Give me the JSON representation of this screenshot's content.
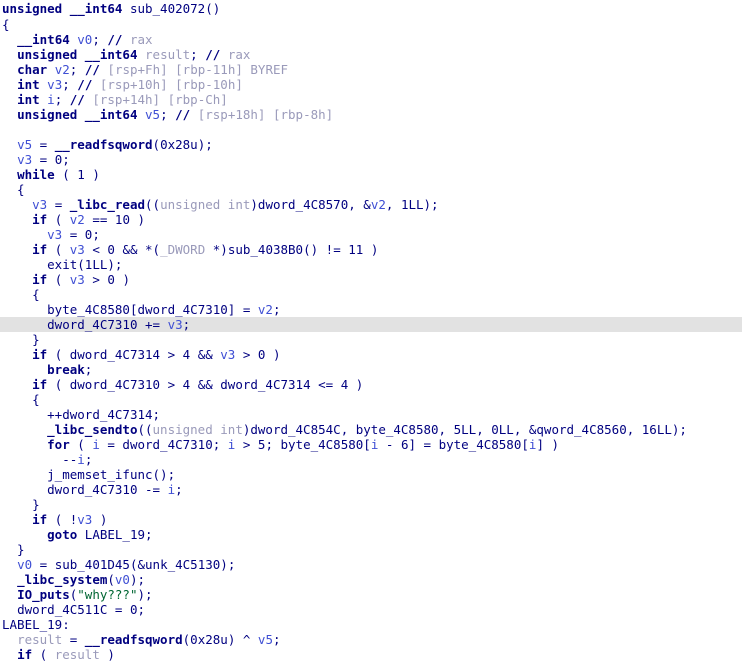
{
  "view": {
    "name": "hex-rays-pseudocode",
    "function_name": "sub_402072",
    "highlighted_line_index": 20,
    "colors": {
      "background": "#ffffff",
      "highlight": "#e2e2e2",
      "keyword": "#000080",
      "local_variable": "#3f4fd4",
      "comment": "#9a9aba",
      "string_literal": "#006633",
      "result_variable": "#9a9aba"
    }
  },
  "lines": [
    {
      "n": 1,
      "text": "unsigned __int64 sub_402072()"
    },
    {
      "n": 2,
      "text": "{"
    },
    {
      "n": 3,
      "text": "  __int64 v0; // rax"
    },
    {
      "n": 4,
      "text": "  unsigned __int64 result; // rax"
    },
    {
      "n": 5,
      "text": "  char v2; // [rsp+Fh] [rbp-11h] BYREF"
    },
    {
      "n": 6,
      "text": "  int v3; // [rsp+10h] [rbp-10h]"
    },
    {
      "n": 7,
      "text": "  int i; // [rsp+14h] [rbp-Ch]"
    },
    {
      "n": 8,
      "text": "  unsigned __int64 v5; // [rsp+18h] [rbp-8h]"
    },
    {
      "n": 9,
      "text": ""
    },
    {
      "n": 10,
      "text": "  v5 = __readfsqword(0x28u);"
    },
    {
      "n": 11,
      "text": "  v3 = 0;"
    },
    {
      "n": 12,
      "text": "  while ( 1 )"
    },
    {
      "n": 13,
      "text": "  {"
    },
    {
      "n": 14,
      "text": "    v3 = _libc_read((unsigned int)dword_4C8570, &v2, 1LL);"
    },
    {
      "n": 15,
      "text": "    if ( v2 == 10 )"
    },
    {
      "n": 16,
      "text": "      v3 = 0;"
    },
    {
      "n": 17,
      "text": "    if ( v3 < 0 && *(_DWORD *)sub_4038B0() != 11 )"
    },
    {
      "n": 18,
      "text": "      exit(1LL);"
    },
    {
      "n": 19,
      "text": "    if ( v3 > 0 )"
    },
    {
      "n": 20,
      "text": "    {"
    },
    {
      "n": 21,
      "text": "      byte_4C8580[dword_4C7310] = v2;"
    },
    {
      "n": 22,
      "text": "      dword_4C7310 += v3;"
    },
    {
      "n": 23,
      "text": "    }"
    },
    {
      "n": 24,
      "text": "    if ( dword_4C7314 > 4 && v3 > 0 )"
    },
    {
      "n": 25,
      "text": "      break;"
    },
    {
      "n": 26,
      "text": "    if ( dword_4C7310 > 4 && dword_4C7314 <= 4 )"
    },
    {
      "n": 27,
      "text": "    {"
    },
    {
      "n": 28,
      "text": "      ++dword_4C7314;"
    },
    {
      "n": 29,
      "text": "      _libc_sendto((unsigned int)dword_4C854C, byte_4C8580, 5LL, 0LL, &qword_4C8560, 16LL);"
    },
    {
      "n": 30,
      "text": "      for ( i = dword_4C7310; i > 5; byte_4C8580[i - 6] = byte_4C8580[i] )"
    },
    {
      "n": 31,
      "text": "        --i;"
    },
    {
      "n": 32,
      "text": "      j_memset_ifunc();"
    },
    {
      "n": 33,
      "text": "      dword_4C7310 -= i;"
    },
    {
      "n": 34,
      "text": "    }"
    },
    {
      "n": 35,
      "text": "    if ( !v3 )"
    },
    {
      "n": 36,
      "text": "      goto LABEL_19;"
    },
    {
      "n": 37,
      "text": "  }"
    },
    {
      "n": 38,
      "text": "  v0 = sub_401D45(&unk_4C5130);"
    },
    {
      "n": 39,
      "text": "  _libc_system(v0);"
    },
    {
      "n": 40,
      "text": "  IO_puts(\"why???\");"
    },
    {
      "n": 41,
      "text": "  dword_4C511C = 0;"
    },
    {
      "n": 42,
      "text": "LABEL_19:"
    },
    {
      "n": 43,
      "text": "  result = __readfsqword(0x28u) ^ v5;"
    },
    {
      "n": 44,
      "text": "  if ( result )"
    }
  ],
  "tokens": {
    "keywords": [
      "unsigned",
      "__int64",
      "char",
      "int",
      "while",
      "if",
      "for",
      "goto",
      "break",
      "result"
    ],
    "local_variables": [
      "v0",
      "v2",
      "v3",
      "i",
      "v5"
    ],
    "globals": [
      "dword_4C8570",
      "dword_4C7310",
      "dword_4C7314",
      "dword_4C854C",
      "dword_4C511C",
      "byte_4C8580",
      "qword_4C8560",
      "unk_4C5130"
    ],
    "functions": [
      "sub_402072",
      "__readfsqword",
      "_libc_read",
      "sub_4038B0",
      "exit",
      "_libc_sendto",
      "j_memset_ifunc",
      "sub_401D45",
      "_libc_system",
      "IO_puts"
    ],
    "string_literals": [
      "\"why???\""
    ],
    "labels": [
      "LABEL_19"
    ],
    "comments": [
      "rax",
      "rax",
      "[rsp+Fh] [rbp-11h] BYREF",
      "[rsp+10h] [rbp-10h]",
      "[rsp+14h] [rbp-Ch]",
      "[rsp+18h] [rbp-8h]"
    ]
  }
}
